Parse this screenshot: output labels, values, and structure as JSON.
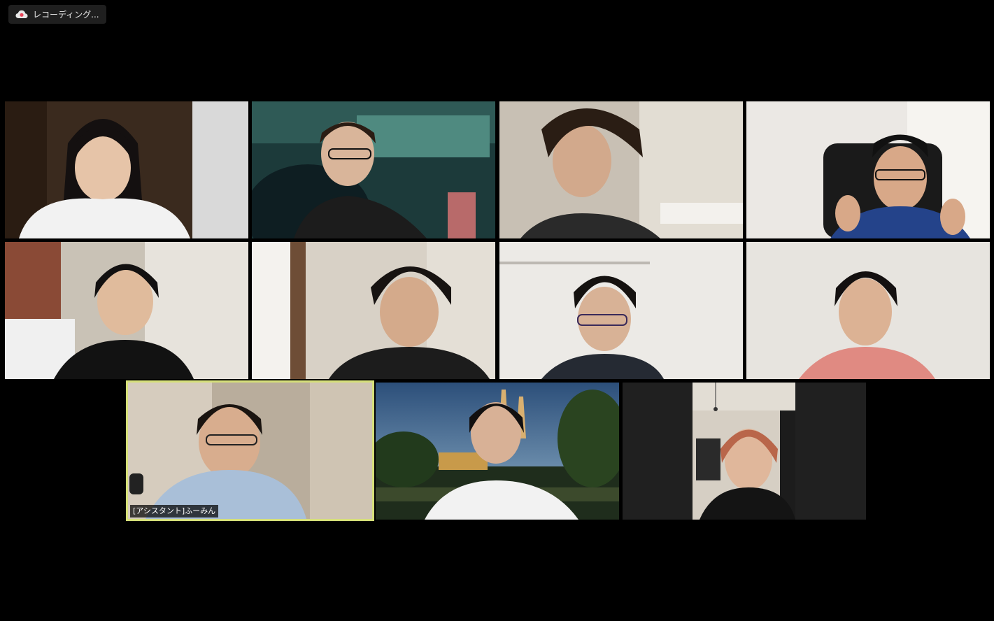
{
  "recording": {
    "label": "レコーディング...",
    "icon": "cloud-recording-icon",
    "icon_color": "#e8455a"
  },
  "active_speaker_color": "#d6e07a",
  "participants": [
    {
      "id": "p1",
      "name": ""
    },
    {
      "id": "p2",
      "name": ""
    },
    {
      "id": "p3",
      "name": ""
    },
    {
      "id": "p4",
      "name": ""
    },
    {
      "id": "p5",
      "name": ""
    },
    {
      "id": "p6",
      "name": ""
    },
    {
      "id": "p7",
      "name": ""
    },
    {
      "id": "p8",
      "name": ""
    },
    {
      "id": "p9",
      "name": "[アシスタント]ふーみん",
      "active": true
    },
    {
      "id": "p10",
      "name": ""
    },
    {
      "id": "p11",
      "name": ""
    }
  ]
}
